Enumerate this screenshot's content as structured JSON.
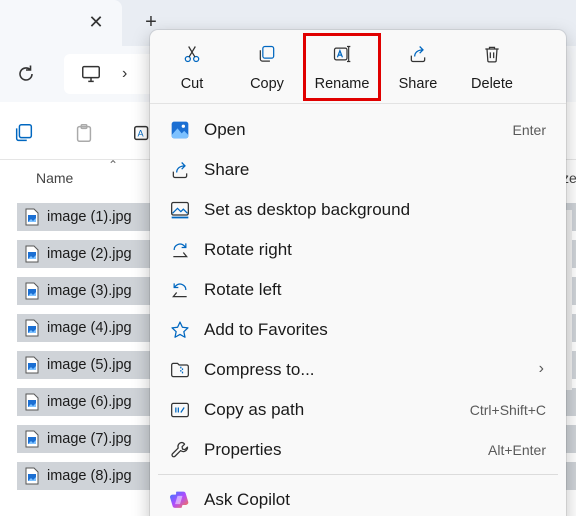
{
  "tab": {
    "close_glyph": "✕",
    "new_tab_glyph": "+"
  },
  "breadcrumb": {
    "chevron": "›"
  },
  "file_list": {
    "column_name": "Name",
    "column_right": "ze",
    "files": [
      "image (1).jpg",
      "image (2).jpg",
      "image (3).jpg",
      "image (4).jpg",
      "image (5).jpg",
      "image (6).jpg",
      "image (7).jpg",
      "image (8).jpg"
    ]
  },
  "context_menu": {
    "quick_actions": [
      {
        "label": "Cut",
        "icon": "scissors-icon"
      },
      {
        "label": "Copy",
        "icon": "copy-icon"
      },
      {
        "label": "Rename",
        "icon": "rename-icon"
      },
      {
        "label": "Share",
        "icon": "share-icon"
      },
      {
        "label": "Delete",
        "icon": "trash-icon"
      }
    ],
    "items": [
      {
        "label": "Open",
        "shortcut": "Enter",
        "icon": "open-image-icon"
      },
      {
        "label": "Share",
        "shortcut": "",
        "icon": "share-icon"
      },
      {
        "label": "Set as desktop background",
        "shortcut": "",
        "icon": "desktop-background-icon"
      },
      {
        "label": "Rotate right",
        "shortcut": "",
        "icon": "rotate-right-icon"
      },
      {
        "label": "Rotate left",
        "shortcut": "",
        "icon": "rotate-left-icon"
      },
      {
        "label": "Add to Favorites",
        "shortcut": "",
        "icon": "star-icon"
      },
      {
        "label": "Compress to...",
        "shortcut": "",
        "icon": "zip-folder-icon"
      },
      {
        "label": "Copy as path",
        "shortcut": "Ctrl+Shift+C",
        "icon": "copy-path-icon"
      },
      {
        "label": "Properties",
        "shortcut": "Alt+Enter",
        "icon": "wrench-icon"
      },
      {
        "label": "Ask Copilot",
        "shortcut": "",
        "icon": "copilot-icon"
      }
    ],
    "compress_chevron": "›"
  },
  "colors": {
    "highlight_box": "#e00000",
    "selected_row": "#cfd3d8",
    "accent_blue": "#0067c0"
  }
}
